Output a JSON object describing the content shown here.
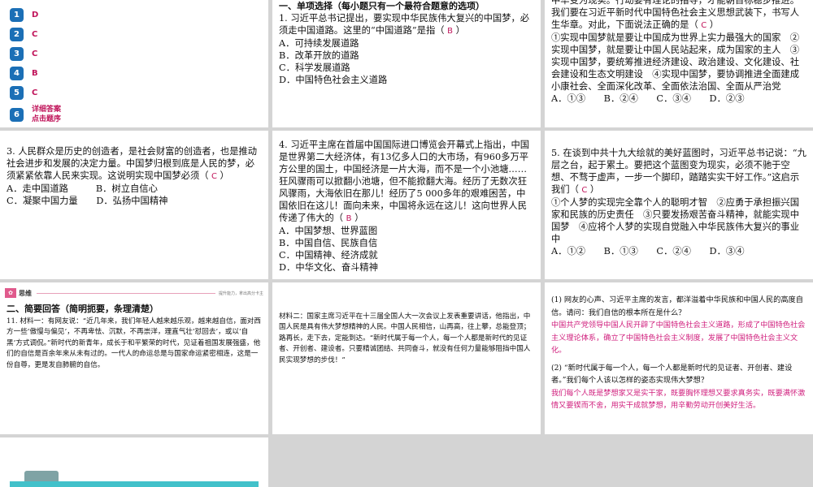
{
  "answers": {
    "items": [
      {
        "num": "1",
        "letter": "D"
      },
      {
        "num": "2",
        "letter": "C"
      },
      {
        "num": "3",
        "letter": "C"
      },
      {
        "num": "4",
        "letter": "B"
      },
      {
        "num": "5",
        "letter": "C"
      },
      {
        "num": "6",
        "letter": "详细答案"
      }
    ],
    "detail_line2": "点击题序"
  },
  "q1": {
    "section_title": "一、单项选择（每小题只有一个最符合题意的选项）",
    "stem_a": "1. 习近平总书记提出，要实现中华民族伟大复兴的中国梦，必须走中国道路。这里的“中国道路”是指（",
    "mark": "B",
    "stem_b": "）",
    "options": [
      "A．可持续发展道路",
      "B．改革开放的道路",
      "C．科学发展道路",
      "D．中国特色社会主义道路"
    ]
  },
  "q2": {
    "stem_a": "中华变为现实。行动要有理论的指导，才能朝目标稳步推进。我们要在习近平新时代中国特色社会主义思想武装下，书写人生华章。对此，下面说法正确的是（",
    "mark": "C",
    "stem_b": "）",
    "body": "①实现中国梦就是要让中国成为世界上实力最强大的国家　②实现中国梦，就是要让中国人民站起来，成为国家的主人　③实现中国梦，要统筹推进经济建设、政治建设、文化建设、社会建设和生态文明建设　④实现中国梦，要协调推进全面建成小康社会、全面深化改革、全面依法治国、全面从严治党",
    "options": "A．①③　　B．②④　　C．③④　　D．②③"
  },
  "q3": {
    "stem_a": "3. 人民群众是历史的创造者，是社会财富的创造者，也是推动社会进步和发展的决定力量。中国梦归根到底是人民的梦，必须紧紧依靠人民来实现。这说明实现中国梦必须（",
    "mark": "C",
    "stem_b": "）",
    "options": [
      "A．走中国道路　　　B．树立自信心",
      "C．凝聚中国力量　　D．弘扬中国精神"
    ]
  },
  "q4": {
    "stem_a": "4. 习近平主席在首届中国国际进口博览会开幕式上指出，中国是世界第二大经济体，有13亿多人口的大市场，有960多万平方公里的国土，中国经济是一片大海，而不是一个小池塘……狂风骤雨可以掀翻小池塘，但不能掀翻大海。经历了无数次狂风骤雨，大海依旧在那儿！经历了5 000多年的艰难困苦，中国依旧在这儿！面向未来，中国将永远在这儿！这向世界人民传递了伟大的（",
    "mark": "B",
    "stem_b": "）",
    "options": [
      "A．中国梦想、世界蓝图",
      "B．中国自信、民族自信",
      "C．中国精神、经济成就",
      "D．中华文化、奋斗精神"
    ]
  },
  "q5": {
    "stem_a": "5. 在谈到中共十九大绘就的美好蓝图时，习近平总书记说：“九层之台，起于累土。要把这个蓝图变为现实，必须不驰于空想、不骛于虚声，一步一个脚印，踏踏实实干好工作。”这启示我们（",
    "mark": "C",
    "stem_b": "）",
    "body": "①个人梦的实现完全靠个人的聪明才智　②应勇于承担振兴国家和民族的历史责任　③只要发扬艰苦奋斗精神，就能实现中国梦　④应将个人梦的实现自觉融入中华民族伟大复兴的事业中",
    "options": "A．①②　　B．①③　　C．②④　　D．③④"
  },
  "q11": {
    "think_label": "思维",
    "think_slogan": "提升能力，拿出高分卡主",
    "section_title": "二、简要回答（简明扼要，条理清楚）",
    "material1": "11. 材料一：有网友说：“近几年来，我们年轻人越来越乐观，越来越自信，面对西方一些‘傲慢与偏见’，不再卑怯、沉默，不再崇洋，理直气壮‘怼回去’，或以‘自黑’方式调侃。”新时代的新青年，成长于和平繁荣的时代，见证着祖国发展强盛，他们的自信是百余年来从未有过的。一代人的命运总是与国家命运紧密相连，这是一份自尊，更是发自肺腑的自信。"
  },
  "material2": "材料二：国家主席习近平在十三届全国人大一次会议上发表重要讲话，他指出，中国人民是具有伟大梦想精神的人民。中国人民相信，山再高，往上攀，总能登顶；路再长，走下去，定能到达。“新时代属于每一个人，每一个人都是新时代的见证者、开创者、建设者。只要精诚团结、共同奋斗，就没有任何力量能够阻挡中国人民实现梦想的步伐！”",
  "sub_q": {
    "q1": "(1) 网友的心声、习近平主席的发言，都洋溢着中华民族和中国人民的高度自信。请问：我们自信的根本所在是什么？",
    "a1": "中国共产党领导中国人民开辟了中国特色社会主义道路，形成了中国特色社会主义理论体系，确立了中国特色社会主义制度，发展了中国特色社会主义文化。",
    "q2": "(2) “新时代属于每一个人，每一个人都是新时代的见证者、开创者、建设者。”我们每个人该以怎样的姿态实现伟大梦想？",
    "a2": "我们每个人既是梦想家又是实干家，既要胸怀理想又要求真务实，既要满怀激情又要锲而不舍，用实干成就梦想，用辛勤劳动开创美好生活。"
  },
  "colors": {
    "answer_pink": "#d01f7d",
    "badge_blue": "#1b6fb6",
    "accent_teal": "#42c1ca"
  }
}
